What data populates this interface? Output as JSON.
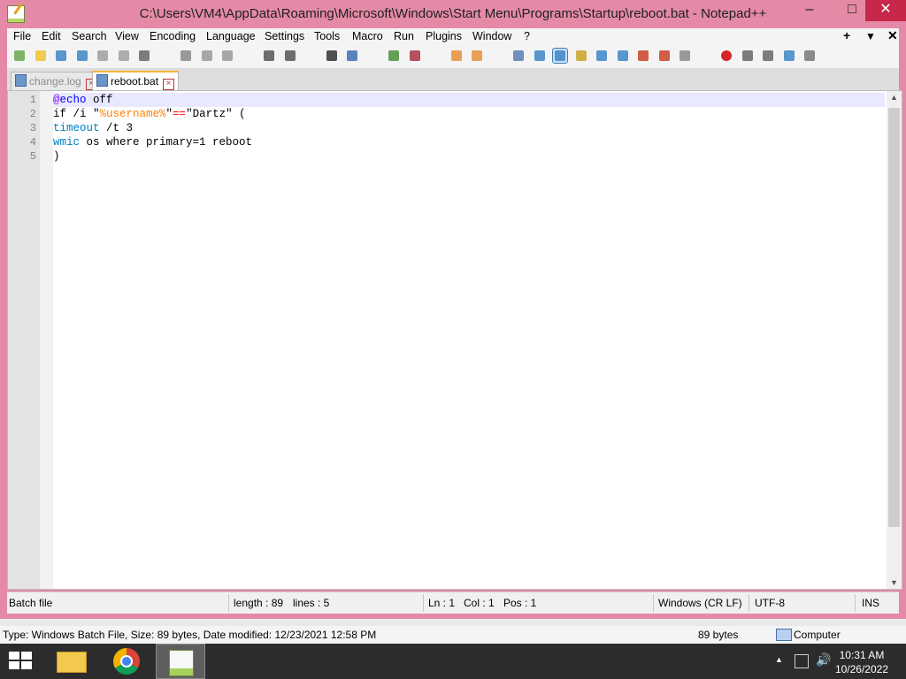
{
  "window": {
    "title": "C:\\Users\\VM4\\AppData\\Roaming\\Microsoft\\Windows\\Start Menu\\Programs\\Startup\\reboot.bat - Notepad++",
    "controls": {
      "minimize": "–",
      "maximize": "□",
      "close": "✕"
    }
  },
  "menu": {
    "items": [
      "File",
      "Edit",
      "Search",
      "View",
      "Encoding",
      "Language",
      "Settings",
      "Tools",
      "Macro",
      "Run",
      "Plugins",
      "Window",
      "?"
    ],
    "right": [
      "+",
      "▼",
      "✕"
    ]
  },
  "toolbar": {
    "icons": [
      "new-file-icon",
      "open-file-icon",
      "save-icon",
      "save-all-icon",
      "close-icon",
      "close-all-icon",
      "print-icon",
      "cut-icon",
      "copy-icon",
      "paste-icon",
      "undo-icon",
      "redo-icon",
      "find-icon",
      "replace-icon",
      "zoom-in-icon",
      "zoom-out-icon",
      "sync-vertical-icon",
      "sync-horizontal-icon",
      "word-wrap-icon",
      "show-all-chars-icon",
      "indent-guide-icon",
      "user-lang-icon",
      "doc-map-icon",
      "function-list-icon",
      "folder-as-workspace-icon",
      "doc-switcher-icon",
      "monitoring-icon",
      "record-macro-icon",
      "stop-macro-icon",
      "play-macro-icon",
      "run-macro-multiple-icon",
      "save-macro-icon"
    ]
  },
  "tabs": [
    {
      "label": "change.log",
      "active": false
    },
    {
      "label": "reboot.bat",
      "active": true
    }
  ],
  "editor": {
    "lines": [
      {
        "num": "1",
        "tokens": [
          {
            "t": "@",
            "c": "#8000ff"
          },
          {
            "t": "echo",
            "c": "#0000ff"
          },
          {
            "t": " off",
            "c": "#000000"
          }
        ]
      },
      {
        "num": "2",
        "tokens": [
          {
            "t": "if /i \"",
            "c": "#000000"
          },
          {
            "t": "%username%",
            "c": "#ff8000"
          },
          {
            "t": "\"",
            "c": "#000000"
          },
          {
            "t": "==",
            "c": "#ff0000"
          },
          {
            "t": "\"Dartz\" (",
            "c": "#000000"
          }
        ]
      },
      {
        "num": "3",
        "tokens": [
          {
            "t": "timeout",
            "c": "#0080c0"
          },
          {
            "t": " /t 3",
            "c": "#000000"
          }
        ]
      },
      {
        "num": "4",
        "tokens": [
          {
            "t": "wmic",
            "c": "#0080c0"
          },
          {
            "t": " os where primary=1 reboot",
            "c": "#000000"
          }
        ]
      },
      {
        "num": "5",
        "tokens": [
          {
            "t": ")",
            "c": "#000000"
          }
        ]
      }
    ]
  },
  "statusbar": {
    "filetype": "Batch file",
    "length": "length : 89",
    "lines": "lines : 5",
    "ln": "Ln : 1",
    "col": "Col : 1",
    "pos": "Pos : 1",
    "eol": "Windows (CR LF)",
    "encoding": "UTF-8",
    "mode": "INS"
  },
  "explorer_info": {
    "details": "Type: Windows Batch File, Size: 89 bytes, Date modified: 12/23/2021 12:58 PM",
    "size": "89 bytes",
    "location": "Computer"
  },
  "taskbar": {
    "apps": [
      "file-explorer-icon",
      "chrome-icon",
      "notepadpp-icon"
    ],
    "time": "10:31 AM",
    "date": "10/26/2022"
  }
}
